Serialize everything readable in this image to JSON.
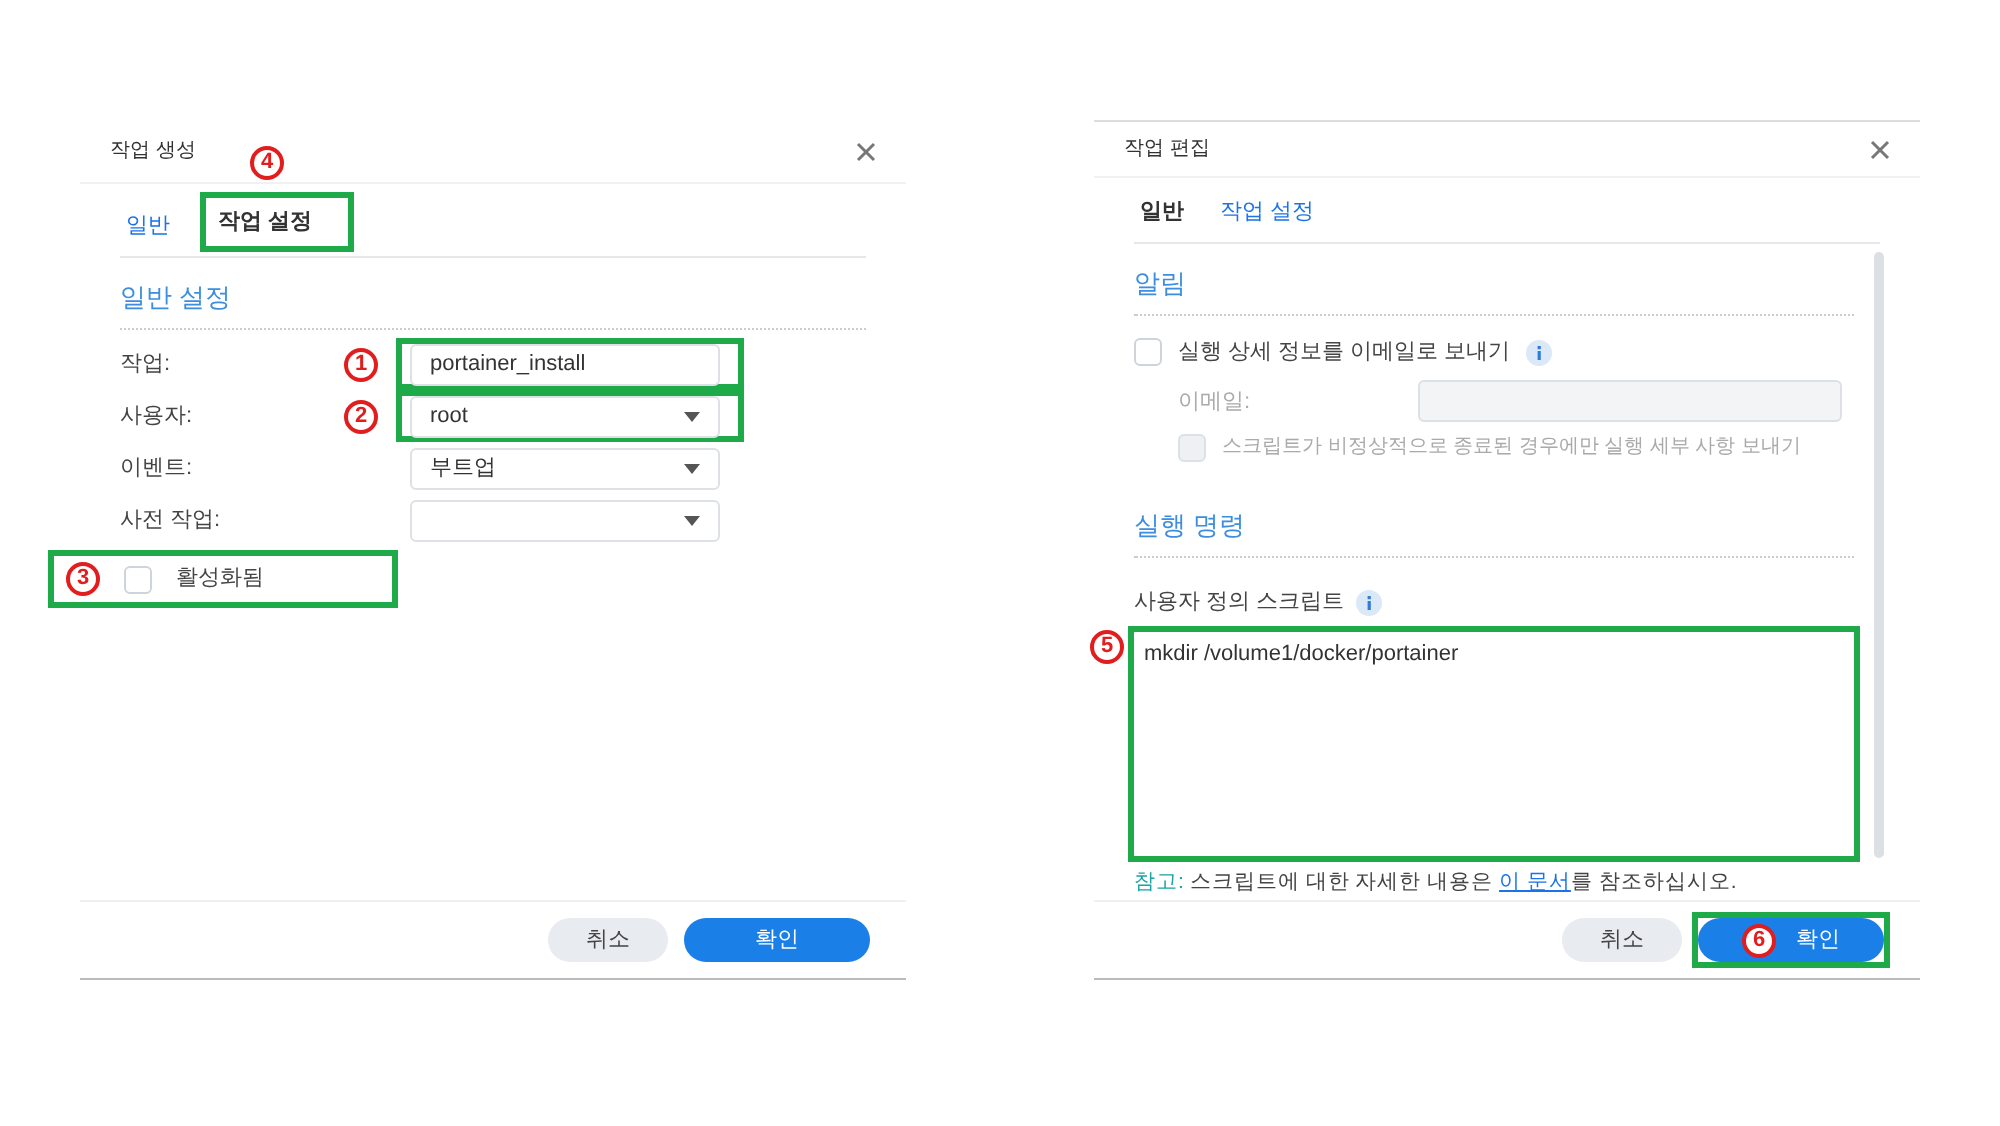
{
  "create_dialog": {
    "title": "작업 생성",
    "tabs": [
      {
        "label": "일반",
        "selected": true,
        "highlighted": false
      },
      {
        "label": "작업 설정",
        "selected": false,
        "highlighted": true,
        "marker": "4"
      }
    ],
    "section_title": "일반 설정",
    "fields": [
      {
        "label": "작업:",
        "kind": "text",
        "value": "portainer_install",
        "highlighted": true,
        "marker": "1"
      },
      {
        "label": "사용자:",
        "kind": "select",
        "value": "root",
        "highlighted": true,
        "marker": "2"
      },
      {
        "label": "이벤트:",
        "kind": "select",
        "value": "부트업",
        "highlighted": false
      },
      {
        "label": "사전 작업:",
        "kind": "select",
        "highlighted": false
      }
    ],
    "checkbox": {
      "label": "활성화됨",
      "checked": false,
      "highlighted": true,
      "marker": "3"
    },
    "buttons": [
      {
        "label": "취소",
        "kind": "secondary",
        "highlighted": false
      },
      {
        "label": "확인",
        "kind": "primary",
        "highlighted": false
      }
    ]
  },
  "edit_dialog": {
    "title": "작업 편집",
    "tabs": [
      {
        "label": "일반",
        "selected": false,
        "highlighted": false
      },
      {
        "label": "작업 설정",
        "selected": true,
        "highlighted": false
      }
    ],
    "notification": {
      "title": "알림",
      "email_option": {
        "label": "실행 상세 정보를 이메일로 보내기",
        "checked": false,
        "disabled": false
      },
      "email_field": {
        "label": "이메일:",
        "disabled": true
      },
      "abnormal_option": {
        "label": "스크립트가 비정상적으로 종료된 경우에만 실행 세부 사항 보내기",
        "checked": false,
        "disabled": true
      }
    },
    "command": {
      "title": "실행 명령",
      "script_label": "사용자 정의 스크립트",
      "script": {
        "value": "mkdir /volume1/docker/portainer",
        "highlighted": true,
        "marker": "5"
      }
    },
    "note": {
      "prefix": "참고:",
      "text": " 스크립트에 대한 자세한 내용은 ",
      "link": "이 문서",
      "suffix": "를 참조하십시오."
    },
    "buttons": [
      {
        "label": "취소",
        "kind": "secondary",
        "highlighted": false
      },
      {
        "label": "확인",
        "kind": "primary",
        "highlighted": true,
        "marker": "6"
      }
    ]
  }
}
